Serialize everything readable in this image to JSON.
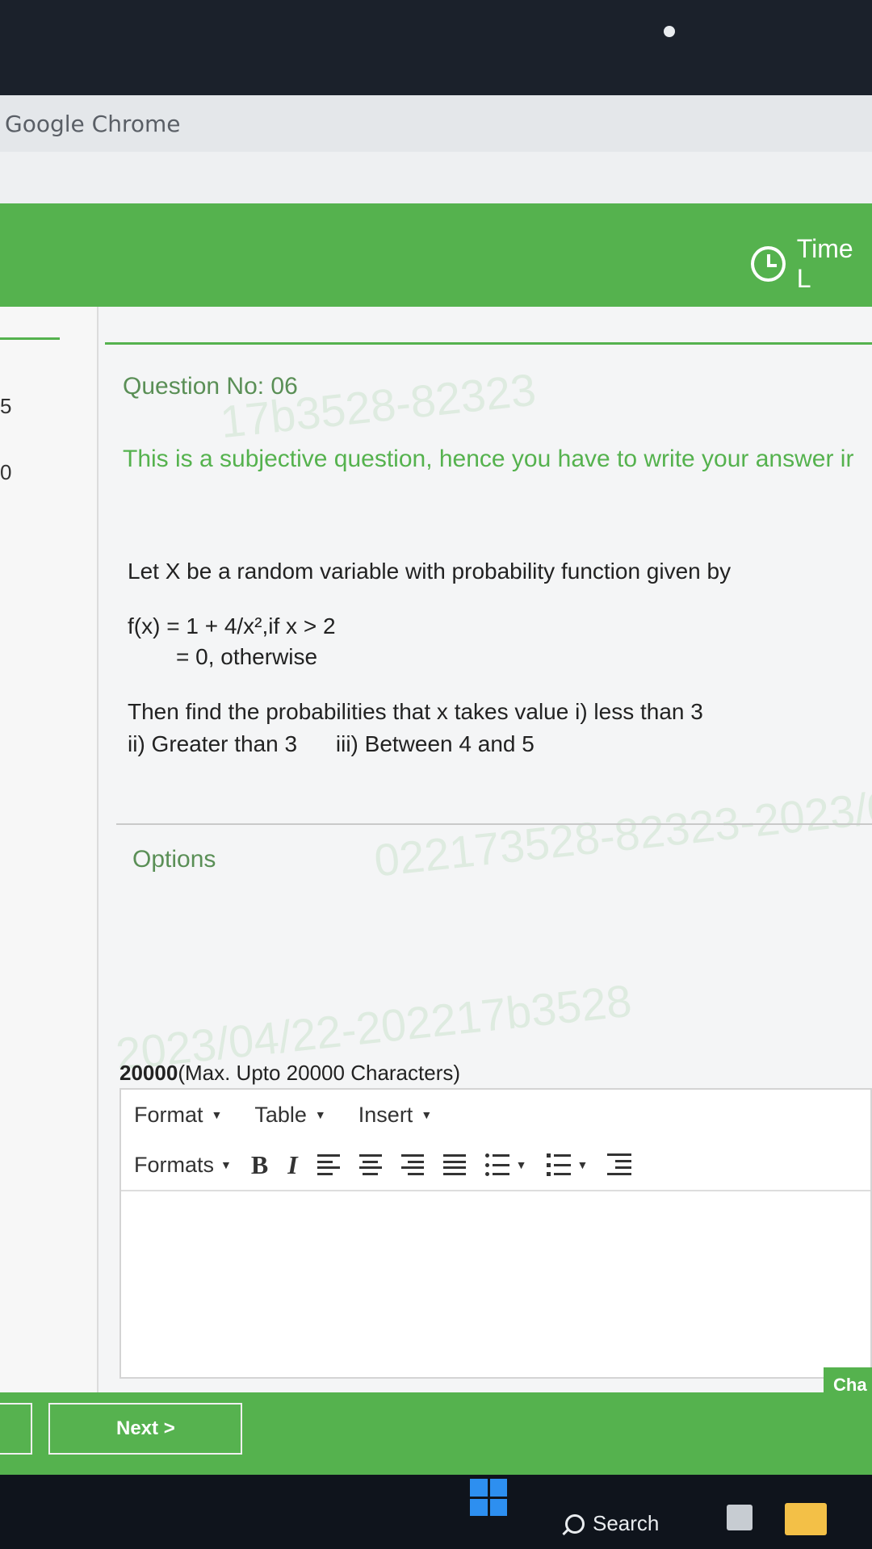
{
  "browser": {
    "title": "Google Chrome"
  },
  "header": {
    "time_label": "Time L"
  },
  "sidebar": {
    "numbers": [
      "5",
      "0"
    ]
  },
  "question": {
    "number_label": "Question No: 06",
    "note": "This is a subjective question, hence you have to write your answer ir",
    "lines": [
      "Let X be a random variable with probability function given by",
      "f(x) = 1 + 4/x²,if x > 2",
      "= 0, otherwise",
      "Then find the probabilities that x takes value i) less than 3",
      "ii) Greater than 3",
      "iii) Between 4 and 5"
    ]
  },
  "options": {
    "label": "Options"
  },
  "answer": {
    "max_count": "20000",
    "max_note": "(Max. Upto 20000 Characters)"
  },
  "editor": {
    "menu": [
      "Format",
      "Table",
      "Insert"
    ],
    "formats_label": "Formats",
    "bold_label": "B",
    "italic_label": "I"
  },
  "navigation": {
    "next_label": "Next >",
    "char_label": "Cha"
  },
  "taskbar": {
    "search_label": "Search"
  },
  "watermark": {
    "text1": "17b3528-82323",
    "text2": "2023/04/22-202217b3528",
    "text3": "022173528-82323-2023/0"
  },
  "colors": {
    "accent": "#55b24e",
    "note_text": "#55b24e",
    "label_text": "#5a8f56"
  }
}
